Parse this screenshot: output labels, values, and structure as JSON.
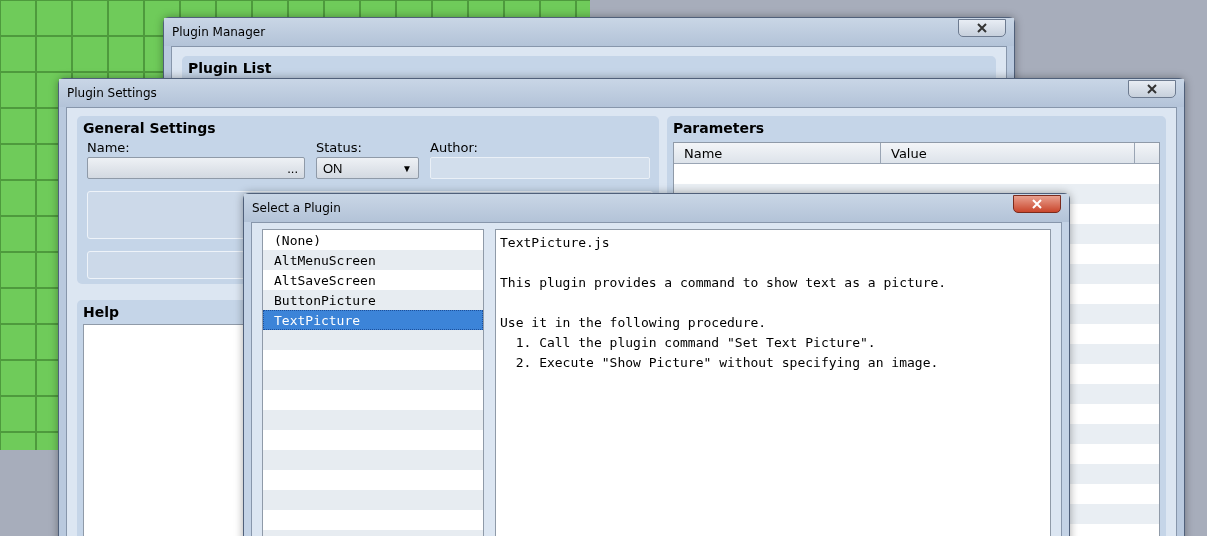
{
  "plugin_manager": {
    "title": "Plugin Manager",
    "plugin_list": {
      "title": "Plugin List"
    }
  },
  "plugin_settings": {
    "title": "Plugin Settings",
    "general_settings": {
      "title": "General Settings",
      "name_label": "Name:",
      "name_button": "...",
      "status_label": "Status:",
      "status_value": "ON",
      "status_arrow": "▼",
      "author_label": "Author:"
    },
    "help": {
      "title": "Help"
    },
    "parameters": {
      "title": "Parameters",
      "columns": [
        "Name",
        "Value"
      ]
    }
  },
  "select_plugin": {
    "title": "Select a Plugin",
    "plugins": [
      {
        "name": "(None)",
        "selected": false
      },
      {
        "name": "AltMenuScreen",
        "selected": false
      },
      {
        "name": "AltSaveScreen",
        "selected": false
      },
      {
        "name": "ButtonPicture",
        "selected": false
      },
      {
        "name": "TextPicture",
        "selected": true
      }
    ],
    "description": [
      [
        "TextPicture.js"
      ],
      [
        "This plugin provides a command to show text as a picture."
      ],
      [
        "Use it in the following procedure.",
        "  1. Call the plugin command \"Set Text Picture\".",
        "  2. Execute \"Show Picture\" without specifying an image."
      ]
    ]
  }
}
